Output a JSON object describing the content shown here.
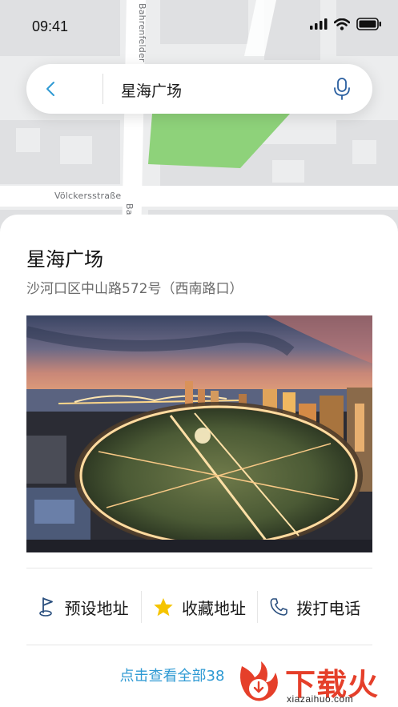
{
  "status_bar": {
    "time": "09:41",
    "icons": [
      "signal-icon",
      "wifi-icon",
      "battery-icon"
    ]
  },
  "map": {
    "streets": [
      "Bahrenfelder",
      "Völckersstraße",
      "Ba"
    ]
  },
  "search": {
    "back_icon": "chevron-left-icon",
    "query": "星海广场",
    "mic_icon": "microphone-icon"
  },
  "place": {
    "name": "星海广场",
    "address": "沙河口区中山路572号（西南路口）",
    "photo": "night-aerial-photo"
  },
  "actions": [
    {
      "label": "预设地址",
      "icon": "flag-icon"
    },
    {
      "label": "收藏地址",
      "icon": "star-icon"
    },
    {
      "label": "拨打电话",
      "icon": "phone-icon"
    }
  ],
  "more_link": "点击查看全部38",
  "watermark": {
    "cn": "下载火",
    "en": "xiazaihuo.com"
  },
  "colors": {
    "accent": "#2f9ad3",
    "star": "#f5c400",
    "watermark": "#e53f2a",
    "park": "#8ed27a"
  }
}
